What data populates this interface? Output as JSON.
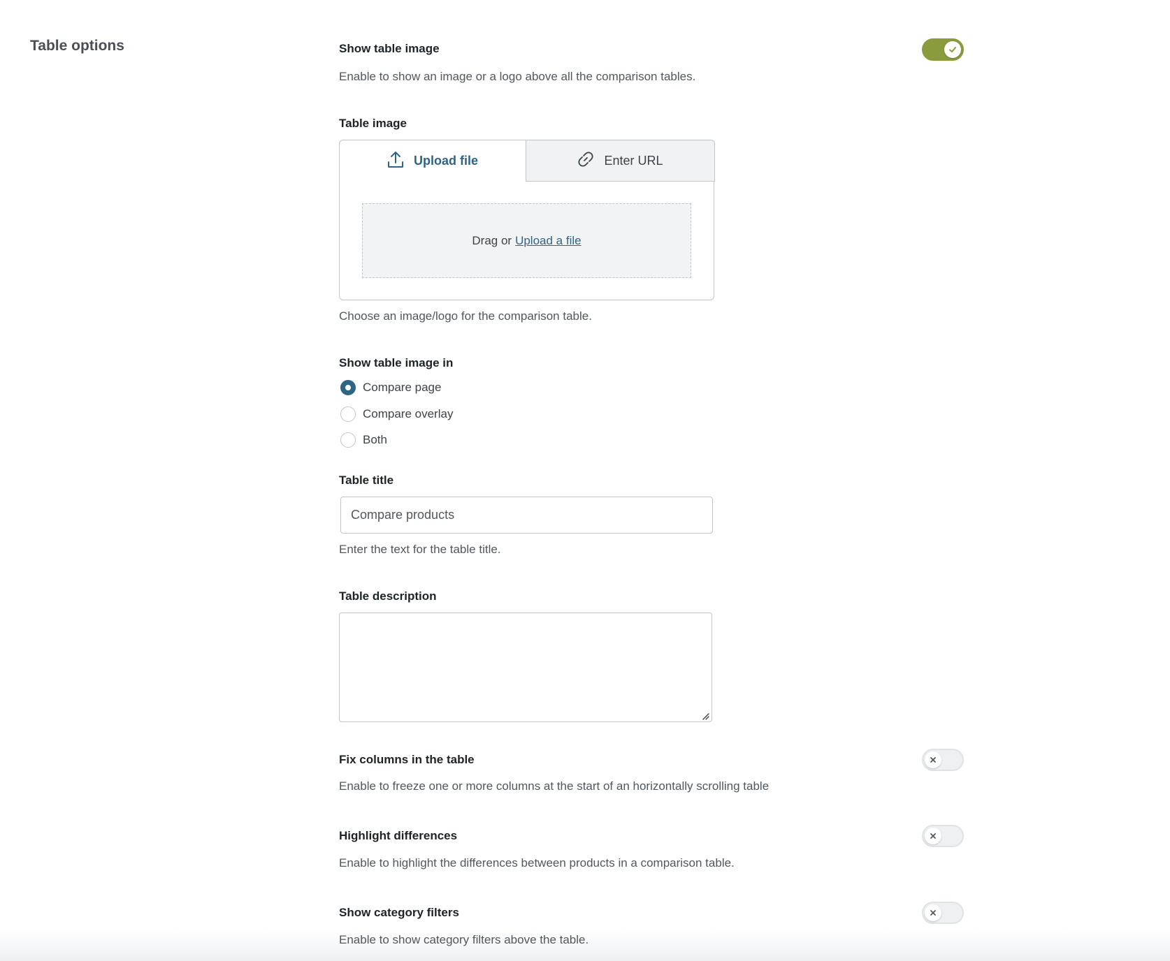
{
  "section": {
    "title": "Table options"
  },
  "show_table_image": {
    "label": "Show table image",
    "description": "Enable to show an image or a logo above all the comparison tables.",
    "enabled": true
  },
  "table_image": {
    "label": "Table image",
    "tabs": {
      "upload": "Upload file",
      "url": "Enter URL"
    },
    "dropzone": {
      "prefix": "Drag or",
      "link": "Upload a file"
    },
    "description": "Choose an image/logo for the comparison table."
  },
  "show_image_in": {
    "label": "Show table image in",
    "options": [
      "Compare page",
      "Compare overlay",
      "Both"
    ],
    "selected": "Compare page"
  },
  "table_title": {
    "label": "Table title",
    "value": "Compare products",
    "description": "Enter the text for the table title."
  },
  "table_description": {
    "label": "Table description",
    "value": ""
  },
  "fix_columns": {
    "label": "Fix columns in the table",
    "description": "Enable to freeze one or more columns at the start of an horizontally scrolling table",
    "enabled": false
  },
  "highlight_differences": {
    "label": "Highlight differences",
    "description": "Enable to highlight the differences between products in a comparison table.",
    "enabled": false
  },
  "category_filters": {
    "label": "Show category filters",
    "description": "Enable to show category filters above the table.",
    "enabled": false
  },
  "colors": {
    "accent": "#2e6585",
    "toggle_on": "#8a9b3d"
  },
  "icons": [
    "check-icon",
    "upload-icon",
    "link-icon",
    "close-icon",
    "resize-grip-icon"
  ]
}
